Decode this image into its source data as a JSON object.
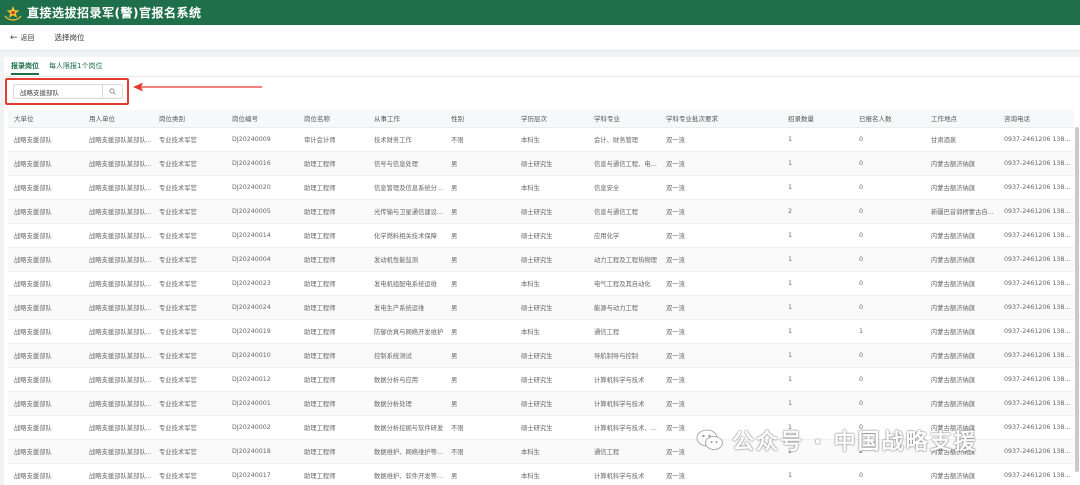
{
  "app": {
    "title": "直接选拔招录军(警)官报名系统"
  },
  "nav": {
    "back_label": "返回",
    "page_title": "选择岗位"
  },
  "tabs": [
    {
      "label": "报录岗位",
      "active": true
    },
    {
      "label": "每人限报1个岗位",
      "active": false
    }
  ],
  "search": {
    "value": "战略支援部队",
    "placeholder": ""
  },
  "table": {
    "columns": [
      "大单位",
      "用人单位",
      "岗位类别",
      "岗位编号",
      "岗位名称",
      "从事工作",
      "性别",
      "学历层次",
      "学科专业",
      "学科专业批次要求",
      "招录数量",
      "已报名人数",
      "工作地点",
      "咨询电话"
    ],
    "rows": [
      [
        "战略支援部队",
        "战略支援部队某部队01",
        "专业技术军官",
        "DJ20240009",
        "审计会计师",
        "技术财务工作",
        "不限",
        "本科生",
        "会计、财务管理",
        "双一流",
        "1",
        "0",
        "甘肃酒泉",
        "0937-2461206 138307..."
      ],
      [
        "战略支援部队",
        "战略支援部队某部队01",
        "专业技术军官",
        "DJ20240016",
        "助理工程师",
        "信号与信息处理",
        "男",
        "硕士研究生",
        "信息与通信工程、电子...",
        "双一流",
        "1",
        "0",
        "内蒙古额济纳旗",
        "0937-2461206 138307..."
      ],
      [
        "战略支援部队",
        "战略支援部队某部队01",
        "专业技术军官",
        "DJ20240020",
        "助理工程师",
        "信息管理及信息系统分...",
        "男",
        "本科生",
        "信息安全",
        "双一流",
        "1",
        "0",
        "内蒙古额济纳旗",
        "0937-2461206 138307..."
      ],
      [
        "战略支援部队",
        "战略支援部队某部队01",
        "专业技术军官",
        "DJ20240005",
        "助理工程师",
        "光传输与卫星通信建设...",
        "男",
        "硕士研究生",
        "信息与通信工程",
        "双一流",
        "2",
        "0",
        "新疆巴音郭楞蒙古自治州",
        "0937-2461206 138307..."
      ],
      [
        "战略支援部队",
        "战略支援部队某部队01",
        "专业技术军官",
        "DJ20240014",
        "助理工程师",
        "化学燃料相关技术保障",
        "男",
        "硕士研究生",
        "应用化学",
        "双一流",
        "1",
        "0",
        "内蒙古额济纳旗",
        "0937-2461206 138307..."
      ],
      [
        "战略支援部队",
        "战略支援部队某部队01",
        "专业技术军官",
        "DJ20240004",
        "助理工程师",
        "发动机性能监测",
        "男",
        "硕士研究生",
        "动力工程及工程热物理",
        "双一流",
        "1",
        "0",
        "内蒙古额济纳旗",
        "0937-2461206 138307..."
      ],
      [
        "战略支援部队",
        "战略支援部队某部队01",
        "专业技术军官",
        "DJ20240023",
        "助理工程师",
        "发电机组配电系统运维",
        "男",
        "本科生",
        "电气工程及其自动化",
        "双一流",
        "1",
        "0",
        "内蒙古额济纳旗",
        "0937-2461206 138307..."
      ],
      [
        "战略支援部队",
        "战略支援部队某部队01",
        "专业技术军官",
        "DJ20240024",
        "助理工程师",
        "发电生产系统运维",
        "男",
        "硕士研究生",
        "能源与动力工程",
        "双一流",
        "1",
        "0",
        "内蒙古额济纳旗",
        "0937-2461206 138307..."
      ],
      [
        "战略支援部队",
        "战略支援部队某部队01",
        "专业技术军官",
        "DJ20240019",
        "助理工程师",
        "防御仿真与网络开发维护",
        "男",
        "本科生",
        "通信工程",
        "双一流",
        "1",
        "1",
        "内蒙古额济纳旗",
        "0937-2461206 138307..."
      ],
      [
        "战略支援部队",
        "战略支援部队某部队01",
        "专业技术军官",
        "DJ20240010",
        "助理工程师",
        "控制系统测试",
        "男",
        "硕士研究生",
        "导航制导与控制",
        "双一流",
        "1",
        "0",
        "内蒙古额济纳旗",
        "0937-2461206 138307..."
      ],
      [
        "战略支援部队",
        "战略支援部队某部队01",
        "专业技术军官",
        "DJ20240012",
        "助理工程师",
        "数据分析与应用",
        "男",
        "硕士研究生",
        "计算机科学与技术",
        "双一流",
        "1",
        "0",
        "内蒙古额济纳旗",
        "0937-2461206 138307..."
      ],
      [
        "战略支援部队",
        "战略支援部队某部队01",
        "专业技术军官",
        "DJ20240001",
        "助理工程师",
        "数据分析处理",
        "男",
        "硕士研究生",
        "计算机科学与技术",
        "双一流",
        "1",
        "0",
        "内蒙古额济纳旗",
        "0937-2461206 138307..."
      ],
      [
        "战略支援部队",
        "战略支援部队某部队01",
        "专业技术军官",
        "DJ20240002",
        "助理工程师",
        "数据分析挖掘与软件研发",
        "不限",
        "硕士研究生",
        "计算机科学与技术、数学",
        "双一流",
        "1",
        "0",
        "内蒙古额济纳旗",
        "0937-2461206 138307..."
      ],
      [
        "战略支援部队",
        "战略支援部队某部队01",
        "专业技术军官",
        "DJ20240018",
        "助理工程师",
        "数据维护、网络维护等...",
        "不限",
        "本科生",
        "通信工程",
        "双一流",
        "2",
        "2",
        "内蒙古额济纳旗",
        "0937-2461206 138307..."
      ],
      [
        "战略支援部队",
        "战略支援部队某部队01",
        "专业技术军官",
        "DJ20240017",
        "助理工程师",
        "数据维护、软件开发等...",
        "男",
        "本科生",
        "计算机科学与技术",
        "双一流",
        "1",
        "0",
        "内蒙古额济纳旗",
        "0937-2461206 138307..."
      ]
    ]
  },
  "watermark": {
    "text": "公众号 · 中国战略支援"
  },
  "colors": {
    "brand": "#1f6f4a",
    "highlight": "#e63a2e"
  }
}
